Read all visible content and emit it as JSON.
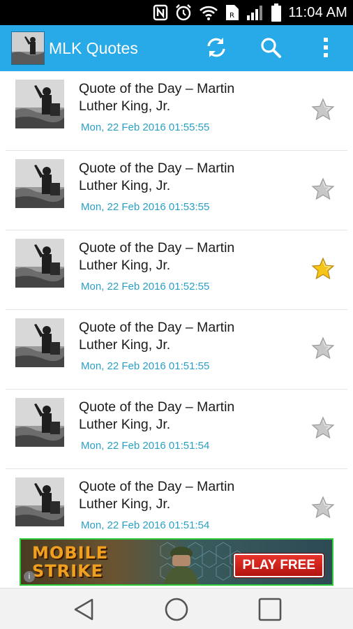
{
  "status_bar": {
    "time": "11:04 AM",
    "icons": [
      "nfc-icon",
      "alarm-icon",
      "wifi-icon",
      "sim-icon",
      "signal-icon",
      "battery-icon"
    ]
  },
  "app_bar": {
    "title": "MLK Quotes",
    "color": "#29aae8",
    "actions": [
      "refresh-icon",
      "search-icon",
      "overflow-menu-icon"
    ]
  },
  "quotes": [
    {
      "title": "Quote of the Day – Martin Luther King, Jr.",
      "date": "Mon, 22 Feb 2016 01:55:55",
      "favorite": false
    },
    {
      "title": "Quote of the Day – Martin Luther King, Jr.",
      "date": "Mon, 22 Feb 2016 01:53:55",
      "favorite": false
    },
    {
      "title": "Quote of the Day – Martin Luther King, Jr.",
      "date": "Mon, 22 Feb 2016 01:52:55",
      "favorite": true
    },
    {
      "title": "Quote of the Day – Martin Luther King, Jr.",
      "date": "Mon, 22 Feb 2016 01:51:55",
      "favorite": false
    },
    {
      "title": "Quote of the Day – Martin Luther King, Jr.",
      "date": "Mon, 22 Feb 2016 01:51:54",
      "favorite": false
    },
    {
      "title": "Quote of the Day – Martin Luther King, Jr.",
      "date": "Mon, 22 Feb 2016 01:51:54",
      "favorite": false
    }
  ],
  "ad": {
    "brand": "MOBILE STRIKE",
    "cta": "PLAY FREE",
    "border_color": "#2ecc3a"
  },
  "colors": {
    "date_text": "#2a9fc6",
    "star_on": "#f5c518",
    "star_off": "#c8c8c8"
  },
  "nav_bar": [
    "back-icon",
    "home-icon",
    "recents-icon"
  ]
}
